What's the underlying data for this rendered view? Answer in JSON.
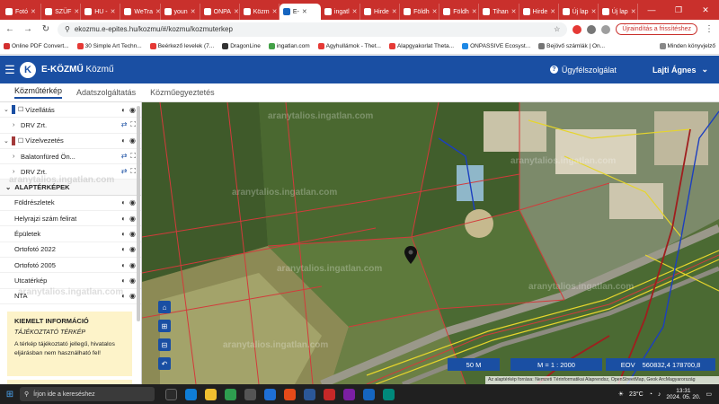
{
  "browser": {
    "tabs": [
      {
        "label": "Fotó",
        "active": false
      },
      {
        "label": "SZÜF",
        "active": false
      },
      {
        "label": "HU -",
        "active": false
      },
      {
        "label": "WeTra",
        "active": false
      },
      {
        "label": "youn",
        "active": false
      },
      {
        "label": "ONPA",
        "active": false
      },
      {
        "label": "Közm",
        "active": false
      },
      {
        "label": "E-",
        "active": true
      },
      {
        "label": "ingatl",
        "active": false
      },
      {
        "label": "Hirde",
        "active": false
      },
      {
        "label": "Földh",
        "active": false
      },
      {
        "label": "Földh",
        "active": false
      },
      {
        "label": "Tihan",
        "active": false
      },
      {
        "label": "Hirde",
        "active": false
      },
      {
        "label": "Új lap",
        "active": false
      },
      {
        "label": "Új lap",
        "active": false
      }
    ],
    "url": "ekozmu.e-epites.hu/kozmu/#/kozmu/kozmuterkep",
    "update_label": "Újraindítás a frissítéshez",
    "bookmarks": [
      {
        "label": "Online PDF Convert...",
        "color": "#d32f2f"
      },
      {
        "label": "30 Simple Art Techn...",
        "color": "#e53935"
      },
      {
        "label": "Beérkező levelek (7...",
        "color": "#e53935"
      },
      {
        "label": "DragonLine",
        "color": "#333333"
      },
      {
        "label": "ingatlan.com",
        "color": "#43a047"
      },
      {
        "label": "Agyhullámok - Thet...",
        "color": "#e53935"
      },
      {
        "label": "Alapgyakorlat Theta...",
        "color": "#e53935"
      },
      {
        "label": "ONPASSIVE Ecosyst...",
        "color": "#1e88e5"
      },
      {
        "label": "Bejövő számlák | On...",
        "color": "#757575"
      }
    ],
    "bookmarks_other": "Minden könyvjelző"
  },
  "app": {
    "logo_letter": "K",
    "brand_bold": "E-KÖZMŰ",
    "brand_light": "Közmű",
    "help_label": "Ügyfélszolgálat",
    "user_name": "Lajti Ágnes"
  },
  "subnav": [
    "Közműtérkép",
    "Adatszolgáltatás",
    "Közműegyeztetés"
  ],
  "sidebar": {
    "layers_top": [
      {
        "label": "Vízellátás",
        "color": "#1a4fa3",
        "type": "group"
      },
      {
        "label": "DRV Zrt.",
        "type": "item"
      },
      {
        "label": "Vízelvezetés",
        "color": "#a33a3a",
        "type": "group"
      },
      {
        "label": "Balatonfüred Ön...",
        "type": "item"
      },
      {
        "label": "DRV Zrt.",
        "type": "item"
      }
    ],
    "base_title": "ALAPTÉRKÉPEK",
    "base_layers": [
      "Földrészletek",
      "Helyrajzi szám felirat",
      "Épületek",
      "Ortofotó 2022",
      "Ortofotó 2005",
      "Utcatérkép",
      "NTA"
    ],
    "info_title": "KIEMELT INFORMÁCIÓ",
    "info_subtitle": "TÁJÉKOZTATÓ TÉRKÉP",
    "info_text": "A térkép tájékoztató jellegű, hivatalos eljárásban nem használható fel!"
  },
  "map": {
    "scale_label": "50 M",
    "ratio_label": "M = 1 : 2000",
    "eov_label": "EOV",
    "eov_value": "560832,4  178700,8",
    "attribution": "Az alaptérkép forrása: Nemzeti Térinformatikai Alaprendsz, OpenStreetMap, Geok ArcMagyarország",
    "watermark": "aranytalios.ingatlan.com"
  },
  "taskbar": {
    "search_placeholder": "Írjon ide a kereséshez",
    "temperature": "23°C",
    "time": "13:31",
    "date": "2024. 05. 20."
  }
}
